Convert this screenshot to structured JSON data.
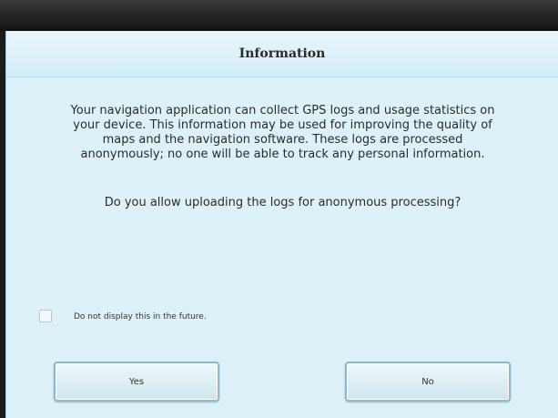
{
  "dialog": {
    "title": "Information",
    "message_lines": [
      "Your navigation application can collect GPS logs and usage statistics on",
      "your device. This information may be used for improving the quality of",
      "maps and the navigation software. These logs are processed",
      "anonymously; no one will be able to track any personal information."
    ],
    "question": "Do you allow uploading the logs for anonymous processing?",
    "checkbox": {
      "label": "Do not display this in the future.",
      "checked": false
    },
    "buttons": {
      "yes_label": "Yes",
      "no_label": "No"
    }
  },
  "colors": {
    "dialog_background": "#ddf2f8",
    "title_bar": "#d2edf5",
    "text": "#2b2b2b",
    "button_border": "#8fb9c8"
  }
}
